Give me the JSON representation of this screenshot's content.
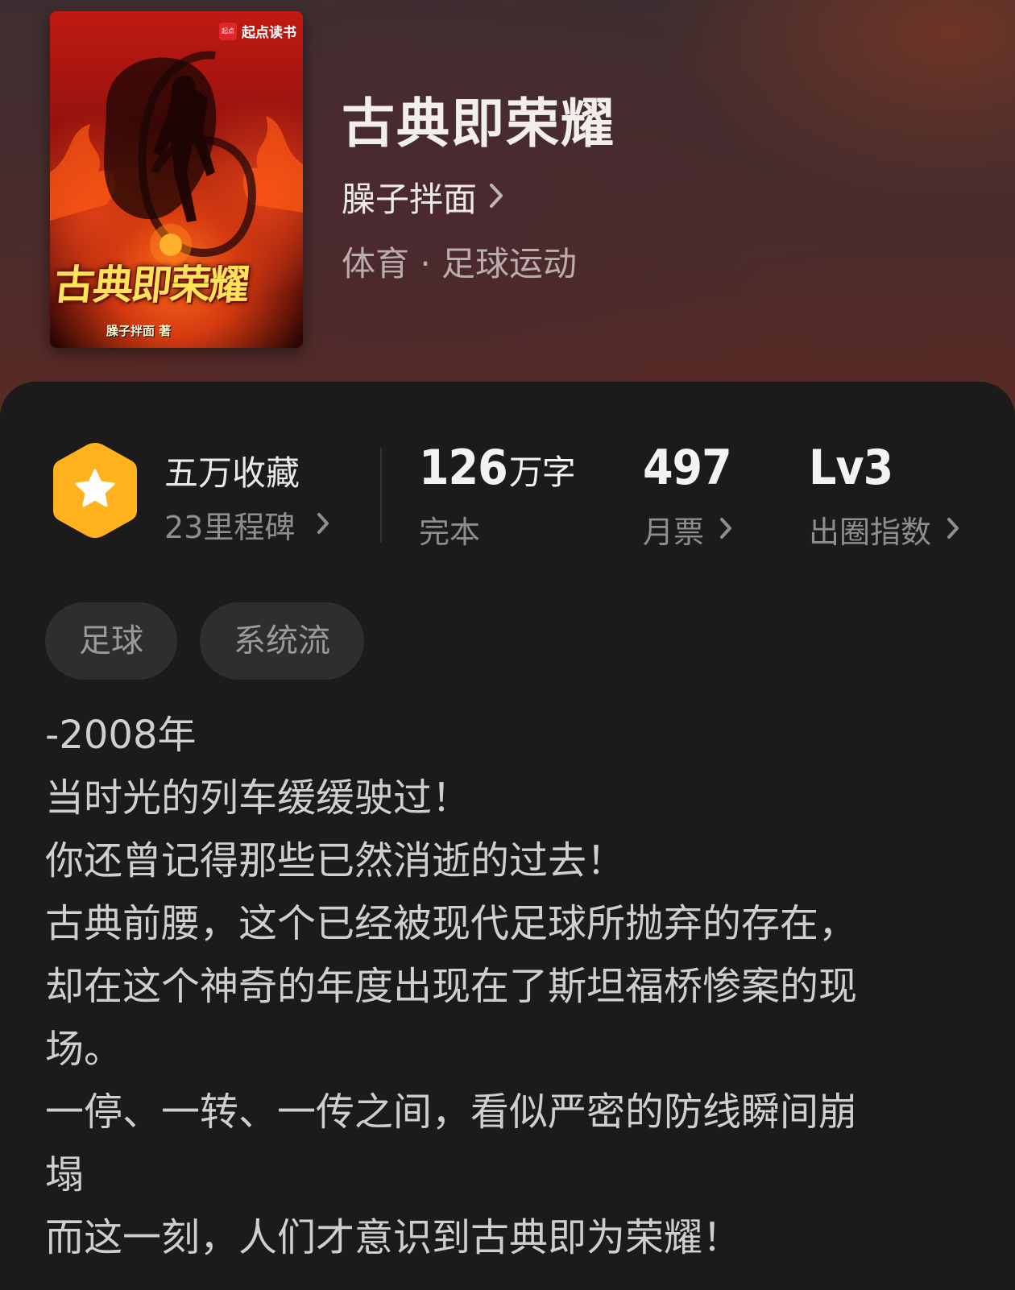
{
  "cover": {
    "publisher_logo": "起点",
    "publisher_name": "起点读书",
    "title": "古典即荣耀",
    "author_credit": "臊子拌面 著"
  },
  "book": {
    "title": "古典即荣耀",
    "author": "臊子拌面",
    "category": "体育 · 足球运动"
  },
  "stats": {
    "favorites": {
      "title": "五万收藏",
      "subtitle": "23里程碑",
      "icon": "star-hexagon-badge-icon"
    },
    "words": {
      "value": "126",
      "unit": "万字",
      "label": "完本"
    },
    "monthly_votes": {
      "value": "497",
      "label": "月票"
    },
    "popularity": {
      "value": "Lv3",
      "label": "出圈指数"
    }
  },
  "tags": [
    "足球",
    "系统流"
  ],
  "description": [
    "-2008年",
    "当时光的列车缓缓驶过！",
    "你还曾记得那些已然消逝的过去！",
    "古典前腰，这个已经被现代足球所抛弃的存在，",
    "却在这个神奇的年度出现在了斯坦福桥惨案的现",
    "场。",
    "一停、一转、一传之间，看似严密的防线瞬间崩",
    "塌",
    "而这一刻，人们才意识到古典即为荣耀！"
  ],
  "colors": {
    "badge": "#ffb21e",
    "panel_bg": "#1b1b1b",
    "tag_bg": "#2e2e2e"
  }
}
